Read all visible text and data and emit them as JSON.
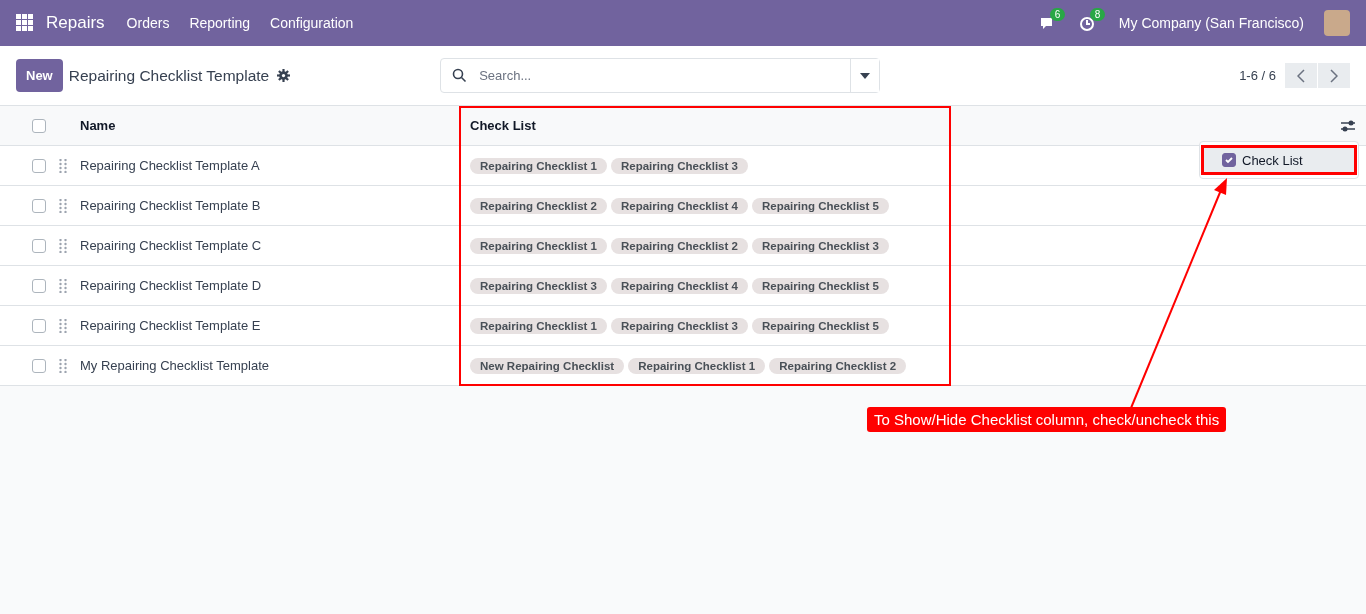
{
  "navbar": {
    "app": "Repairs",
    "menu": [
      "Orders",
      "Reporting",
      "Configuration"
    ],
    "messages_count": "6",
    "activities_count": "8",
    "company": "My Company (San Francisco)"
  },
  "control_panel": {
    "new_button": "New",
    "title": "Repairing Checklist Template",
    "search": {
      "placeholder": "Search..."
    },
    "pager": "1-6 / 6"
  },
  "table": {
    "columns": [
      "Name",
      "Check List"
    ],
    "select_all": false,
    "rows": [
      {
        "name": "Repairing Checklist Template A",
        "selected": false,
        "checklist": [
          "Repairing Checklist 1",
          "Repairing Checklist 3"
        ]
      },
      {
        "name": "Repairing Checklist Template B",
        "selected": false,
        "checklist": [
          "Repairing Checklist 2",
          "Repairing Checklist 4",
          "Repairing Checklist 5"
        ]
      },
      {
        "name": "Repairing Checklist Template C",
        "selected": false,
        "checklist": [
          "Repairing Checklist 1",
          "Repairing Checklist 2",
          "Repairing Checklist 3"
        ]
      },
      {
        "name": "Repairing Checklist Template D",
        "selected": false,
        "checklist": [
          "Repairing Checklist 3",
          "Repairing Checklist 4",
          "Repairing Checklist 5"
        ]
      },
      {
        "name": "Repairing Checklist Template E",
        "selected": false,
        "checklist": [
          "Repairing Checklist 1",
          "Repairing Checklist 3",
          "Repairing Checklist 5"
        ]
      },
      {
        "name": "My Repairing Checklist Template",
        "selected": false,
        "checklist": [
          "New Repairing Checklist",
          "Repairing Checklist 1",
          "Repairing Checklist 2"
        ]
      }
    ]
  },
  "optional_columns": [
    {
      "label": "Check List",
      "checked": true
    }
  ],
  "annotation": {
    "text": "To Show/Hide Checklist column, check/uncheck this"
  }
}
